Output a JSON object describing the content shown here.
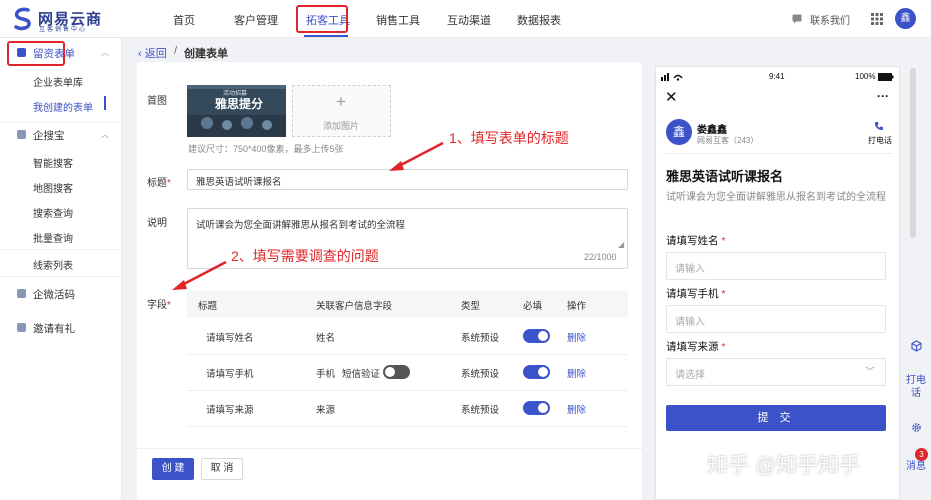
{
  "brand": {
    "name": "网易云商",
    "tagline": "互客销售中心"
  },
  "nav": {
    "items": [
      "首页",
      "客户管理",
      "拓客工具",
      "销售工具",
      "互动渠道",
      "数据报表"
    ],
    "active": "拓客工具",
    "contact": "联系我们",
    "avatar": "鑫"
  },
  "sidebar": {
    "group1": "留资表单",
    "item_library": "企业表单库",
    "item_mine": "我创建的表单",
    "group2": "企搜宝",
    "item_smart": "智能搜客",
    "item_map": "地图搜客",
    "item_search": "搜索查询",
    "item_batch": "批量查询",
    "item_leads": "线索列表",
    "group3": "企微活码",
    "group4": "邀请有礼"
  },
  "breadcrumb": {
    "back": "返回",
    "separator": "/",
    "title": "创建表单"
  },
  "form": {
    "cover_label": "首图",
    "cover_text": "雅思提分",
    "cover_tag": "活动招募",
    "add_image": "添加图片",
    "hint": "建议尺寸：750*400像素，最多上传5张",
    "title_label": "标题",
    "title_value": "雅思英语试听课报名",
    "desc_label": "说明",
    "desc_value": "试听课会为您全面讲解雅思从报名到考试的全流程",
    "counter": "22/1000",
    "fields_label": "字段",
    "required_mark": "*",
    "table_headers": [
      "标题",
      "关联客户信息字段",
      "类型",
      "必填",
      "操作"
    ],
    "rows": [
      {
        "title": "请填写姓名",
        "field": "姓名",
        "extra": "",
        "type": "系统预设",
        "required": true,
        "action": "删除"
      },
      {
        "title": "请填写手机",
        "field": "手机",
        "extra": "短信验证",
        "type": "系统预设",
        "required": true,
        "action": "删除"
      },
      {
        "title": "请填写来源",
        "field": "来源",
        "extra": "",
        "type": "系统预设",
        "required": true,
        "action": "删除"
      }
    ],
    "annotation1": "1、填写表单的标题",
    "annotation2": "2、填写需要调查的问题",
    "create_btn": "创 建",
    "cancel_btn": "取 消"
  },
  "preview": {
    "time": "9:41",
    "battery": "100%",
    "name": "娄鑫鑫",
    "company": "网易互客（243）",
    "avatar": "鑫",
    "call": "打电话",
    "title": "雅思英语试听课报名",
    "desc": "试听课会为您全面讲解雅思从报名到考试的全流程",
    "q1": "请填写姓名",
    "q2": "请填写手机",
    "q3": "请填写来源",
    "req": "*",
    "placeholder_input": "请输入",
    "placeholder_select": "请选择",
    "submit": "提 交"
  },
  "float": {
    "call": "打电话",
    "messages": "消息",
    "badge": "3"
  },
  "watermark": "知乎 @知乎知乎",
  "colors": {
    "primary": "#3c52c8",
    "highlight": "#e0262a"
  }
}
